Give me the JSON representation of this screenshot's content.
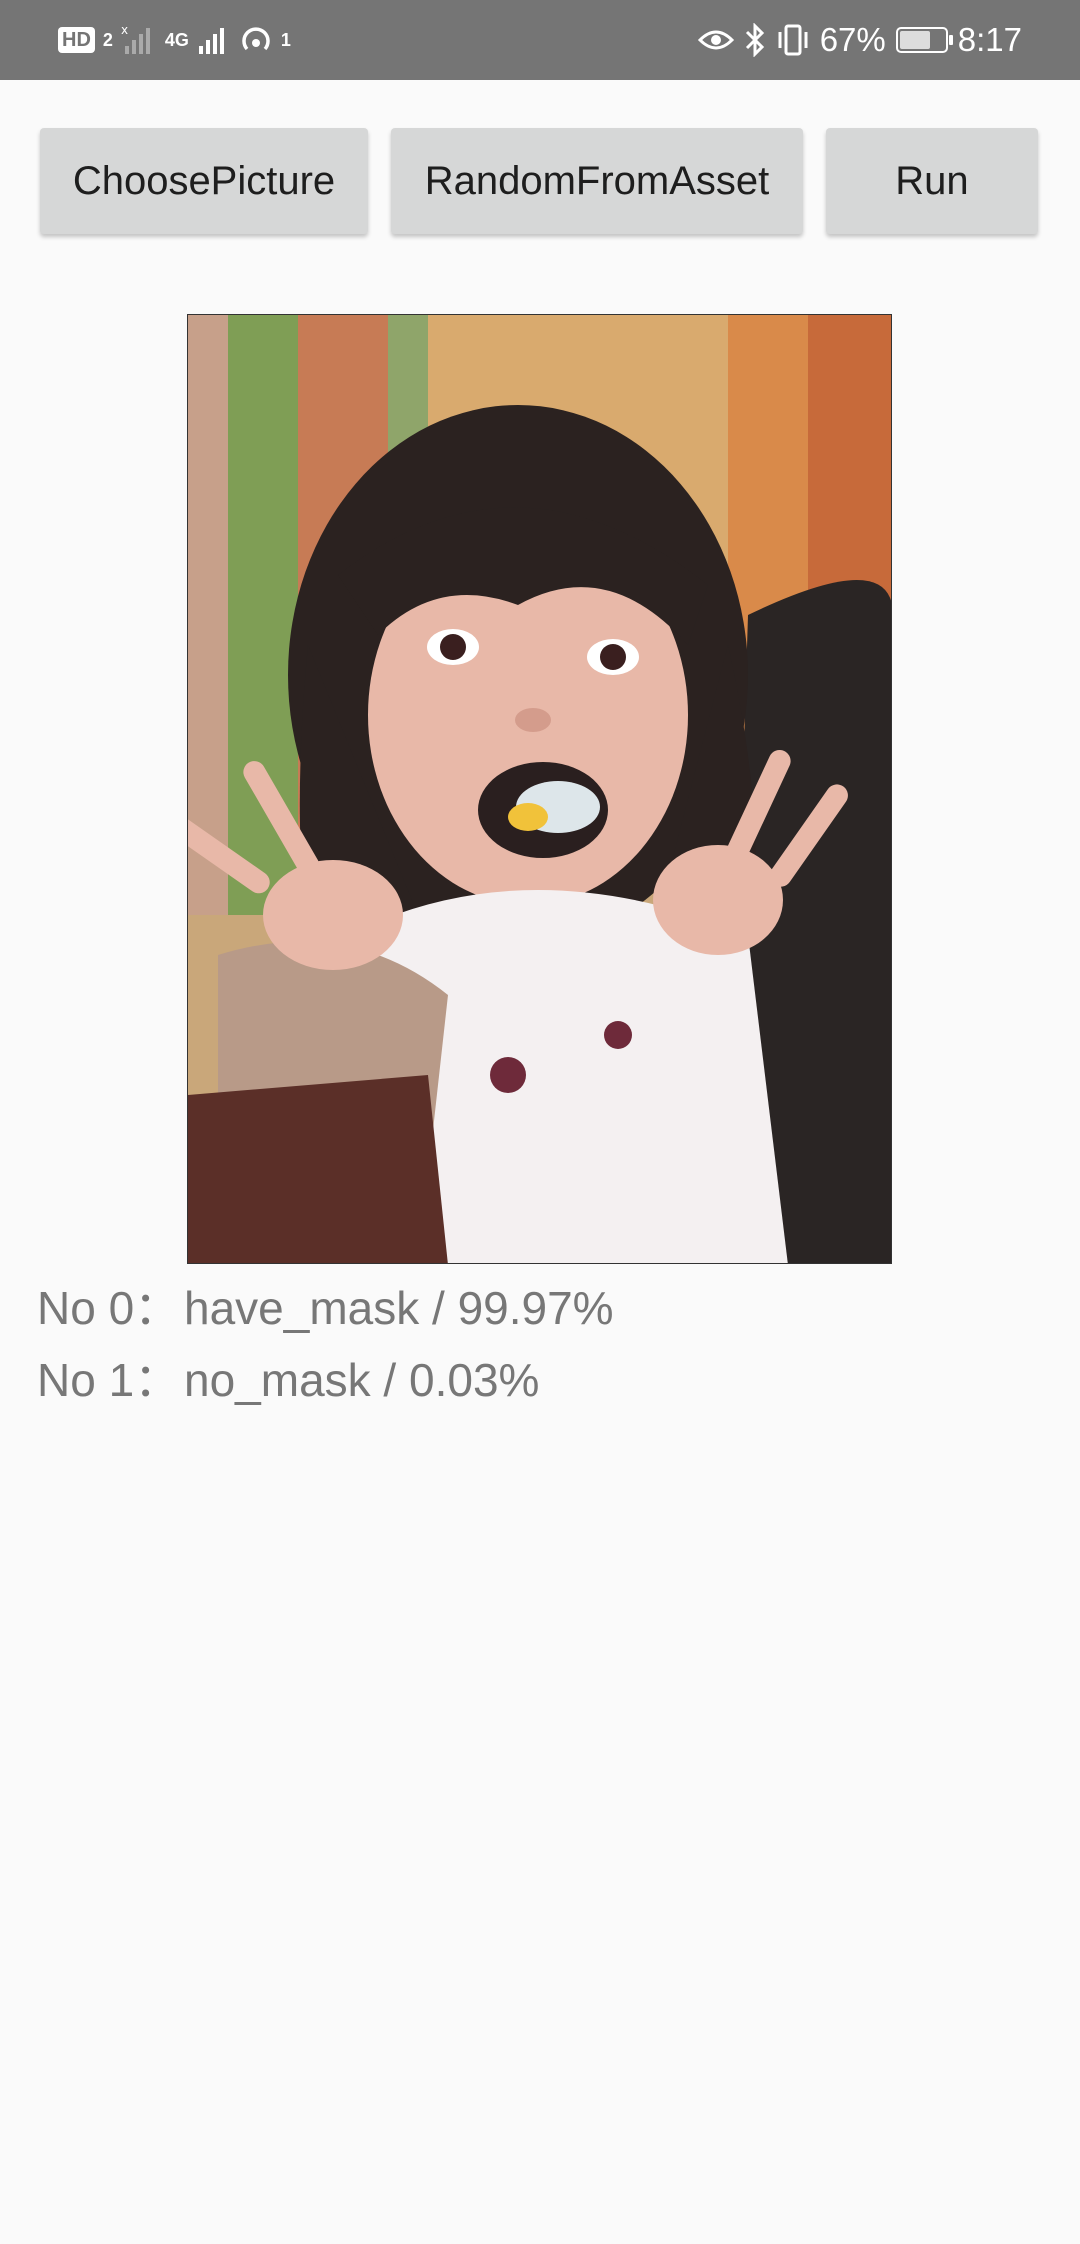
{
  "status_bar": {
    "hd_label": "HD",
    "sim_slot": "2",
    "network_type": "4G",
    "hotspot_count": "1",
    "battery_percent": "67%",
    "time": "8:17",
    "icons": [
      "hd-icon",
      "signal-x-icon",
      "signal-4g-icon",
      "hotspot-icon",
      "eye-icon",
      "bluetooth-icon",
      "vibrate-icon",
      "battery-icon"
    ]
  },
  "toolbar": {
    "choose_label": "ChoosePicture",
    "random_label": "RandomFromAsset",
    "run_label": "Run"
  },
  "image": {
    "alt": "photo of a girl eating with a spoon"
  },
  "results": [
    {
      "index": "No 0：",
      "text": "have_mask / 99.97%"
    },
    {
      "index": "No 1：",
      "text": "no_mask / 0.03%"
    }
  ],
  "colors": {
    "status_bar_bg": "#757575",
    "button_bg": "#d6d7d7",
    "page_bg": "#fafafa",
    "result_text": "#777777"
  }
}
